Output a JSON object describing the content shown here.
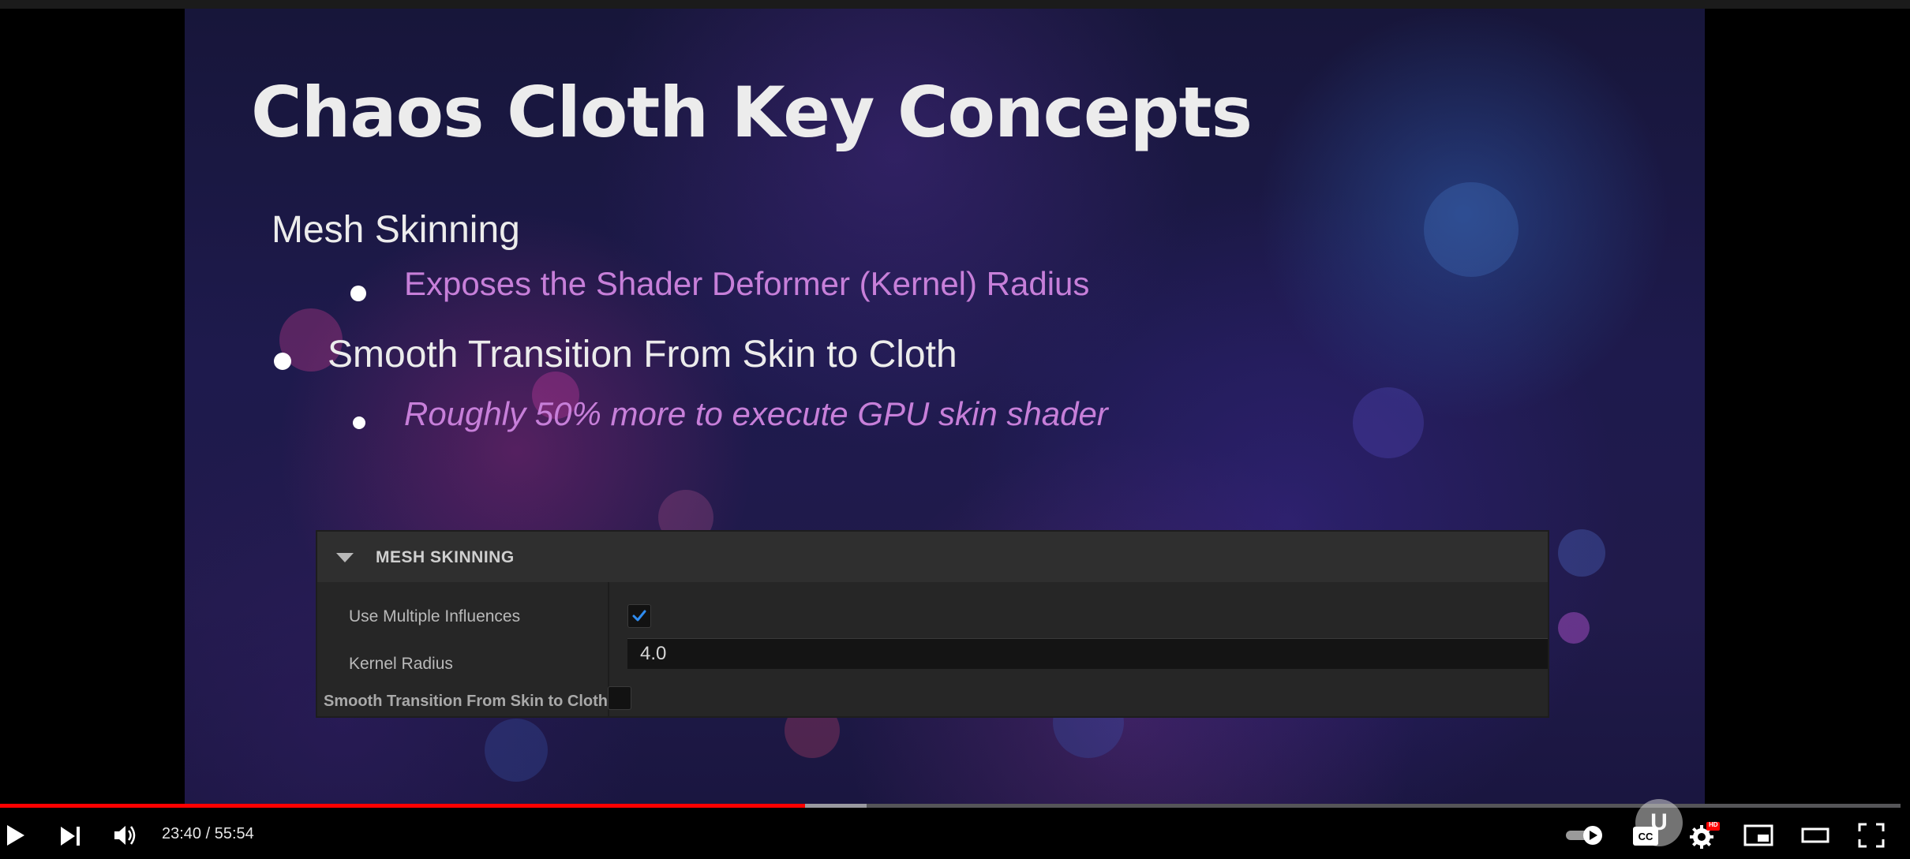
{
  "slide": {
    "title": "Chaos Cloth Key Concepts",
    "heading": "Mesh Skinning",
    "sub_point_1": "Exposes the Shader Deformer (Kernel) Radius",
    "main_point": "Smooth Transition From Skin to Cloth",
    "sub_point_2": "Roughly 50% more to execute GPU skin shader"
  },
  "details_panel": {
    "section_title": "MESH SKINNING",
    "rows": [
      {
        "label": "Use Multiple Influences",
        "checked": true
      },
      {
        "label": "Kernel Radius",
        "value": "4.0"
      },
      {
        "label": "Smooth Transition From Skin to Cloth",
        "checked": false
      }
    ]
  },
  "player": {
    "current_time": "23:40",
    "duration": "55:54",
    "time_display": "23:40 / 55:54",
    "played_fraction": 0.4234,
    "buffered_fraction": 0.4556,
    "hd_badge": "HD",
    "icons": [
      "play-icon",
      "next-icon",
      "volume-icon",
      "autoplay-toggle-icon",
      "captions-icon",
      "settings-icon",
      "miniplayer-icon",
      "theater-mode-icon",
      "fullscreen-icon"
    ],
    "accent_color": "#ff0000"
  }
}
